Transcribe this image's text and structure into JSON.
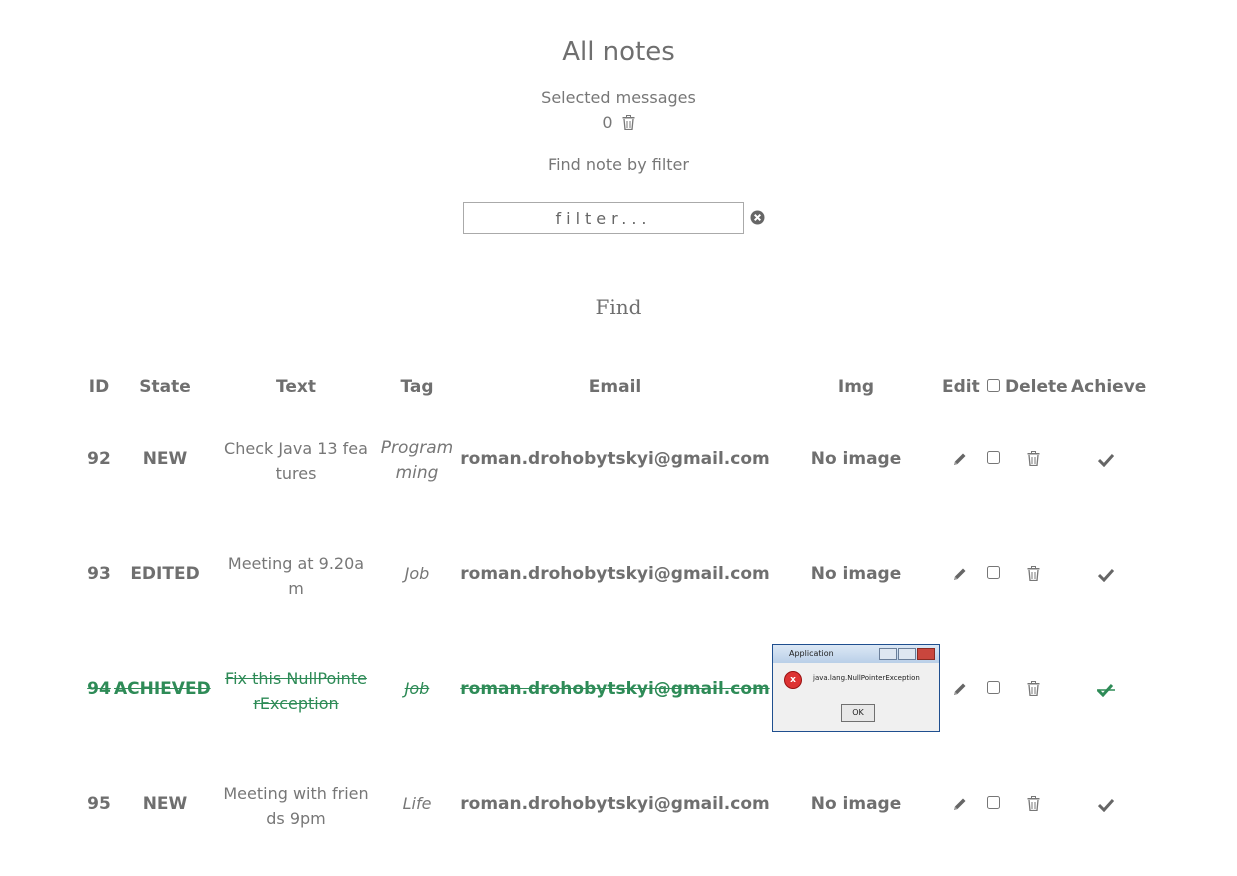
{
  "page": {
    "title": "All notes"
  },
  "selection": {
    "label": "Selected messages",
    "count": "0"
  },
  "filter": {
    "label": "Find note by filter",
    "placeholder": "filter...",
    "find_label": "Find"
  },
  "table": {
    "headers": {
      "id": "ID",
      "state": "State",
      "text": "Text",
      "tag": "Tag",
      "email": "Email",
      "img": "Img",
      "edit": "Edit",
      "delete": "Delete",
      "achieve": "Achieve"
    },
    "rows": [
      {
        "id": "92",
        "state": "NEW",
        "text_line1": "Check Java 13 fea",
        "text_line2": "tures",
        "tag_line1": "Program",
        "tag_line2": "ming",
        "email": "roman.drohobytskyi@gmail.com",
        "img": "No image"
      },
      {
        "id": "93",
        "state": "EDITED",
        "text_line1": "Meeting at 9.20a",
        "text_line2": "m",
        "tag_line1": "Job",
        "tag_line2": "",
        "email": "roman.drohobytskyi@gmail.com",
        "img": "No image"
      },
      {
        "id": "94",
        "state": "ACHIEVED",
        "text_line1": "Fix this NullPointe",
        "text_line2": "rException",
        "tag_line1": "Job",
        "tag_line2": "",
        "email": "roman.drohobytskyi@gmail.com",
        "img_window": {
          "title": "Application",
          "message": "java.lang.NullPointerException",
          "button": "OK"
        }
      },
      {
        "id": "95",
        "state": "NEW",
        "text_line1": "Meeting with frien",
        "text_line2": "ds 9pm",
        "tag_line1": "Life",
        "tag_line2": "",
        "email": "roman.drohobytskyi@gmail.com",
        "img": "No image"
      }
    ]
  },
  "colors": {
    "text": "#777777",
    "achieved": "#2e8b57"
  }
}
